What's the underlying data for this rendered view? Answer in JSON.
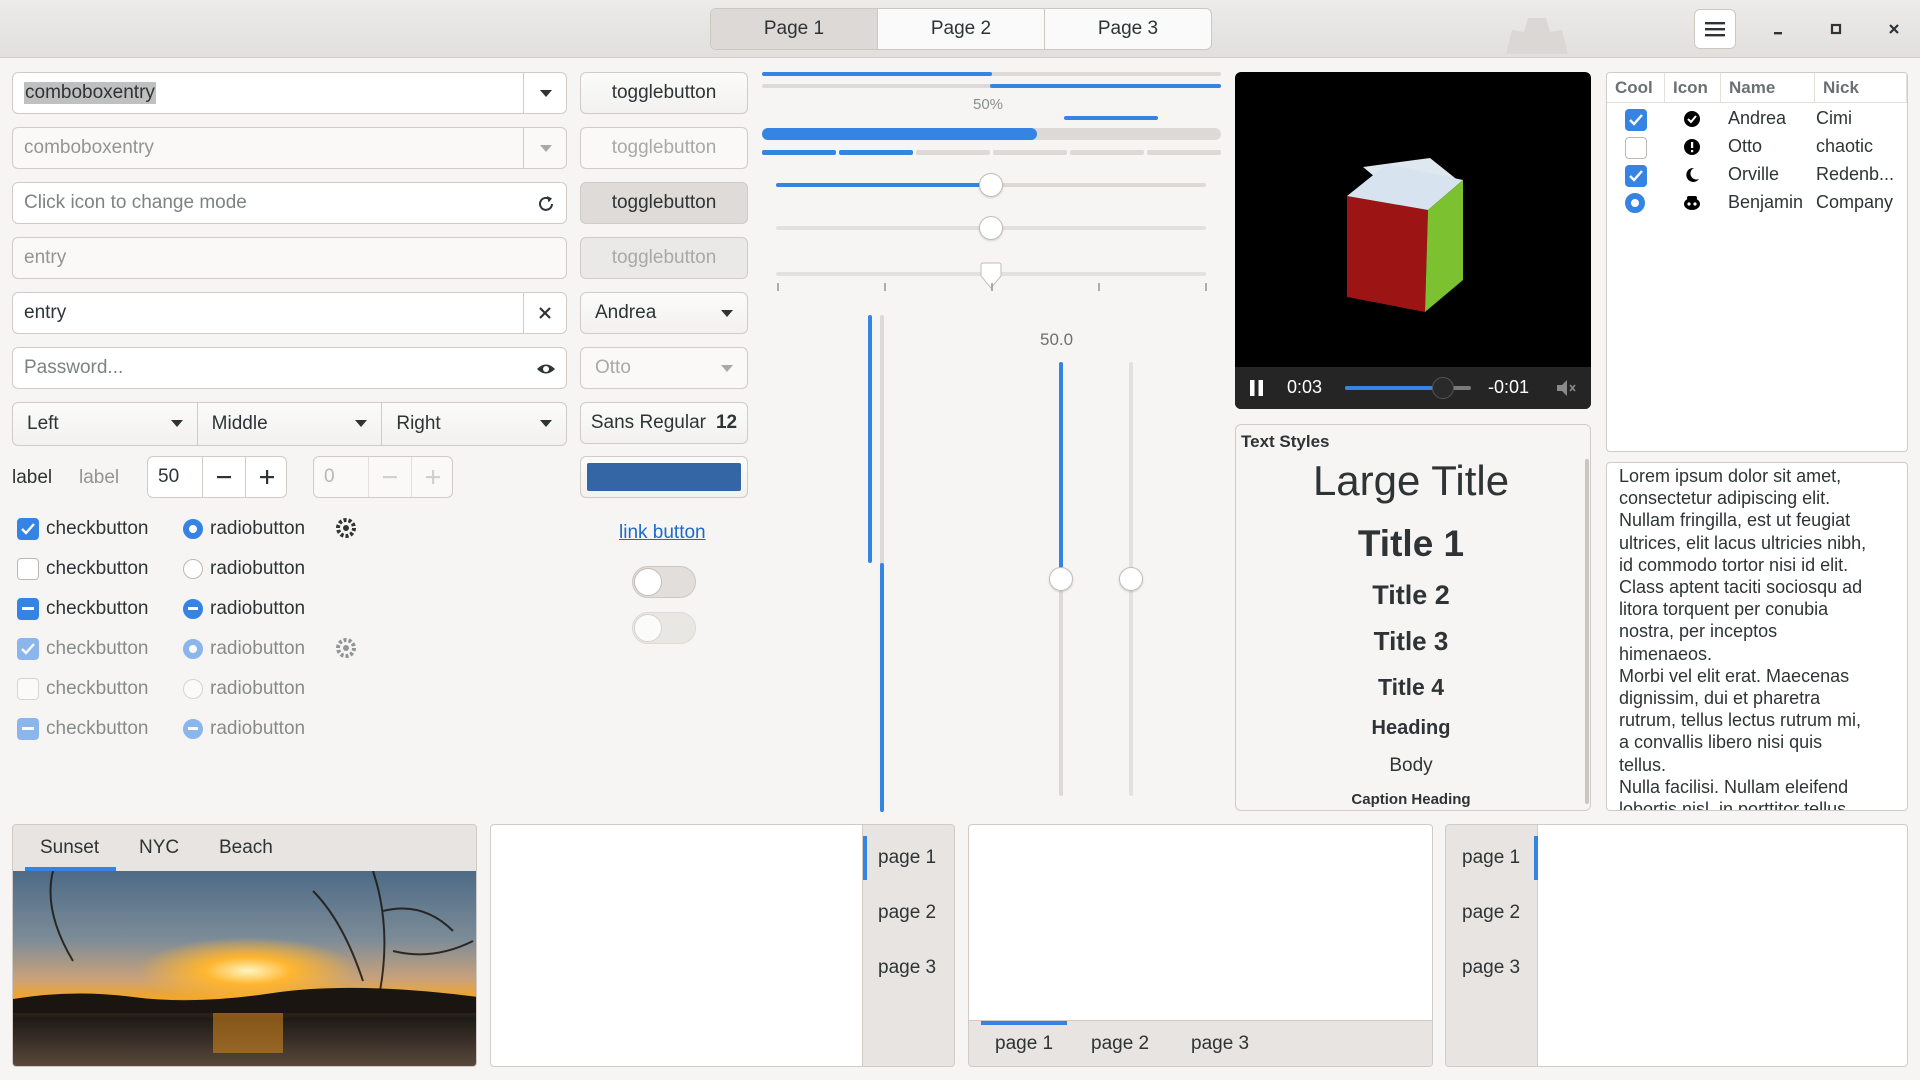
{
  "header": {
    "pages": [
      "Page 1",
      "Page 2",
      "Page 3"
    ],
    "active_page": 0
  },
  "left": {
    "combo_entry": "comboboxentry",
    "combo_entry_disabled": "comboboxentry",
    "mode_entry_placeholder": "Click icon to change mode",
    "entry_placeholder": "entry",
    "entry_value": "entry",
    "password_placeholder": "Password...",
    "linked_combos": [
      "Left",
      "Middle",
      "Right"
    ],
    "label1": "label",
    "label2": "label",
    "spin_value": "50",
    "spin_disabled_value": "0",
    "check_label": "checkbutton",
    "radio_label": "radiobutton"
  },
  "mid": {
    "toggle_label": "togglebutton",
    "combo_andrea": "Andrea",
    "combo_otto": "Otto",
    "font_name": "Sans Regular",
    "font_size": "12",
    "color_swatch": "#3465a4",
    "link_label": "link button"
  },
  "progress": {
    "percent_label": "50%",
    "bar1": 0.5,
    "bar3": 0.6,
    "level_segments": 6,
    "level_filled": 2
  },
  "sliders": {
    "h1": 0.5,
    "h2": 0.5,
    "h3": 0.5,
    "v_value_label": "50.0",
    "v1": 0.5,
    "v2": 0.5
  },
  "video": {
    "time_elapsed": "0:03",
    "time_remaining": "-0:01",
    "seek": 0.78
  },
  "text_styles": {
    "title": "Text Styles",
    "large_title": "Large Title",
    "title1": "Title 1",
    "title2": "Title 2",
    "title3": "Title 3",
    "title4": "Title 4",
    "heading": "Heading",
    "body": "Body",
    "caption_heading": "Caption Heading"
  },
  "tree": {
    "columns": [
      "Cool",
      "Icon",
      "Name",
      "Nick"
    ],
    "rows": [
      {
        "cool": "checked",
        "icon": "check-circle-icon",
        "name": "Andrea",
        "nick": "Cimi"
      },
      {
        "cool": "unchecked",
        "icon": "exclamation-circle-icon",
        "name": "Otto",
        "nick": "chaotic"
      },
      {
        "cool": "checked",
        "icon": "moon-icon",
        "name": "Orville",
        "nick": "Redenb..."
      },
      {
        "cool": "radio",
        "icon": "face-icon",
        "name": "Benjamin",
        "nick": "Company"
      }
    ]
  },
  "textview": {
    "lines": [
      "Lorem ipsum dolor sit amet,",
      "consectetur adipiscing elit.",
      "Nullam fringilla, est ut feugiat",
      "ultrices, elit lacus ultricies nibh,",
      "id commodo tortor nisi id elit.",
      "Class aptent taciti sociosqu ad",
      "litora torquent per conubia",
      "nostra, per inceptos",
      "himenaeos.",
      "Morbi vel elit erat. Maecenas",
      "dignissim, dui et pharetra",
      "rutrum, tellus lectus rutrum mi,",
      "a convallis libero nisi quis",
      "tellus.",
      "Nulla facilisi. Nullam eleifend",
      "lobortis nisl, in porttitor tellus"
    ]
  },
  "bottom": {
    "photo_tabs": [
      "Sunset",
      "NYC",
      "Beach"
    ],
    "notebook_pages": [
      "page 1",
      "page 2",
      "page 3"
    ]
  }
}
